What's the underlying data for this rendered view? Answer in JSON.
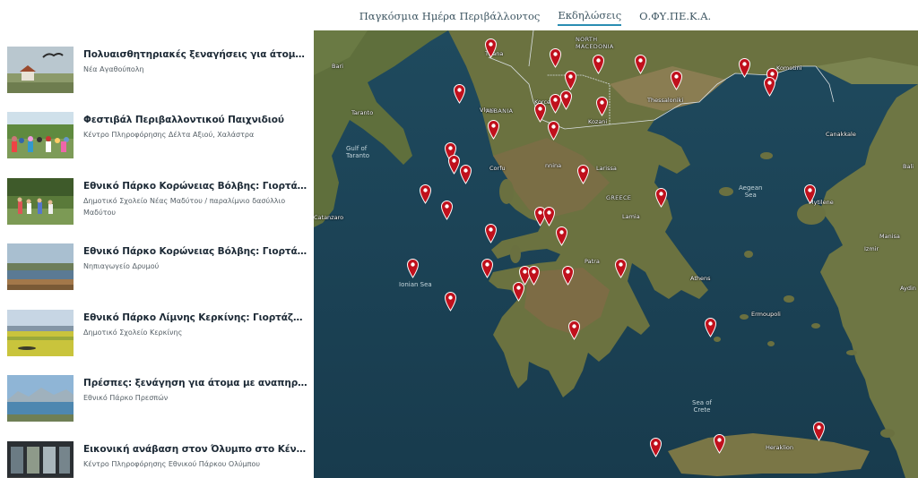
{
  "nav": {
    "items": [
      {
        "label": "Παγκόσμια Ημέρα Περιβάλλοντος",
        "active": false
      },
      {
        "label": "Εκδηλώσεις",
        "active": true
      },
      {
        "label": "Ο.ΦΥ.ΠΕ.Κ.Α.",
        "active": false
      }
    ]
  },
  "events": [
    {
      "title": "Πολυαισθητηριακές ξεναγήσεις για άτομα με αναπηρία",
      "location": "Νέα Αγαθούπολη"
    },
    {
      "title": "Φεστιβάλ Περιβαλλοντικού Παιχνιδιού",
      "location": "Κέντρο Πληροφόρησης Δέλτα Αξιού, Χαλάστρα"
    },
    {
      "title": "Εθνικό Πάρκο Κορώνειας Βόλβης: Γιορτάζουμε την Παγκόσμια Ημέρα Περιβάλλοντος",
      "location": "Δημοτικό Σχολείο Νέας Μαδύτου / παραλίμνιο δασύλλιο Μαδύτου"
    },
    {
      "title": "Εθνικό Πάρκο Κορώνειας Βόλβης: Γιορτάζουμε την Παγκόσμια Ημέρα Περιβάλλοντος",
      "location": "Νηπιαγωγείο Δρυμού"
    },
    {
      "title": "Εθνικό Πάρκο Λίμνης Κερκίνης: Γιορτάζουμε την Παγκόσμια Ημέρα Περιβάλλοντος",
      "location": "Δημοτικό Σχολείο Κερκίνης"
    },
    {
      "title": "Πρέσπες: ξενάγηση για άτομα με αναπηρία όρασης",
      "location": "Εθνικό Πάρκο Πρεσπών"
    },
    {
      "title": "Εικονική ανάβαση στον Όλυμπο στο Κέντρο Πληροφόρησης",
      "location": "Κέντρο Πληροφόρησης Εθνικού Πάρκου Ολύμπου"
    }
  ],
  "map": {
    "labels": {
      "north_macedonia": "NORTH\nMACEDONIA",
      "albania": "ALBANIA",
      "greece": "GREECE",
      "tirana": "Tirana",
      "bari": "Bari",
      "taranto": "Taranto",
      "gulf_taranto": "Gulf of\nTaranto",
      "vlore": "Vlore",
      "korce": "Korce",
      "kozani": "Kozani",
      "thessaloniki": "Thessaloniki",
      "komotini": "Komotini",
      "canakkale": "Canakkale",
      "bali": "Bali",
      "corfu": "Corfu",
      "ioannina": "nnina",
      "larissa": "Larissa",
      "lamia": "Lamia",
      "catanzaro": "Catanzaro",
      "aegean_sea": "Aegean\nSea",
      "mytilene": "Mytilene",
      "izmir": "Izmir",
      "manisa": "Manisa",
      "ionian_sea": "Ionian Sea",
      "patra": "Patra",
      "athens": "Athens",
      "ermoupoli": "Ermoupoli",
      "aydin": "Aydin",
      "sea_of_crete": "Sea of\nCrete",
      "heraklion": "Heraklion"
    },
    "pin_color": "#c0101c",
    "marker_icon": "map-pin-icon",
    "markers": [
      {
        "lng": 21.4,
        "lat": 41.45
      },
      {
        "lng": 22.45,
        "lat": 41.3
      },
      {
        "lng": 23.15,
        "lat": 41.2
      },
      {
        "lng": 23.82,
        "lat": 41.2
      },
      {
        "lng": 25.5,
        "lat": 41.15
      },
      {
        "lng": 25.95,
        "lat": 41.0
      },
      {
        "lng": 22.7,
        "lat": 40.95
      },
      {
        "lng": 24.4,
        "lat": 40.95
      },
      {
        "lng": 25.9,
        "lat": 40.85
      },
      {
        "lng": 20.9,
        "lat": 40.75
      },
      {
        "lng": 22.62,
        "lat": 40.65
      },
      {
        "lng": 22.45,
        "lat": 40.6
      },
      {
        "lng": 23.2,
        "lat": 40.55
      },
      {
        "lng": 22.2,
        "lat": 40.45
      },
      {
        "lng": 21.45,
        "lat": 40.2
      },
      {
        "lng": 22.42,
        "lat": 40.18
      },
      {
        "lng": 20.75,
        "lat": 39.85
      },
      {
        "lng": 20.82,
        "lat": 39.65
      },
      {
        "lng": 21.0,
        "lat": 39.5
      },
      {
        "lng": 22.9,
        "lat": 39.5
      },
      {
        "lng": 24.15,
        "lat": 39.15
      },
      {
        "lng": 26.55,
        "lat": 39.2
      },
      {
        "lng": 20.35,
        "lat": 39.2
      },
      {
        "lng": 20.7,
        "lat": 38.95
      },
      {
        "lng": 22.2,
        "lat": 38.85
      },
      {
        "lng": 22.35,
        "lat": 38.85
      },
      {
        "lng": 21.4,
        "lat": 38.6
      },
      {
        "lng": 22.55,
        "lat": 38.55
      },
      {
        "lng": 20.15,
        "lat": 38.05
      },
      {
        "lng": 21.35,
        "lat": 38.05
      },
      {
        "lng": 23.5,
        "lat": 38.05
      },
      {
        "lng": 21.95,
        "lat": 37.95
      },
      {
        "lng": 22.1,
        "lat": 37.95
      },
      {
        "lng": 22.65,
        "lat": 37.95
      },
      {
        "lng": 21.85,
        "lat": 37.7
      },
      {
        "lng": 20.75,
        "lat": 37.55
      },
      {
        "lng": 22.75,
        "lat": 37.1
      },
      {
        "lng": 24.95,
        "lat": 37.15
      },
      {
        "lng": 24.07,
        "lat": 35.3
      },
      {
        "lng": 25.1,
        "lat": 35.35
      },
      {
        "lng": 26.7,
        "lat": 35.55
      }
    ]
  }
}
